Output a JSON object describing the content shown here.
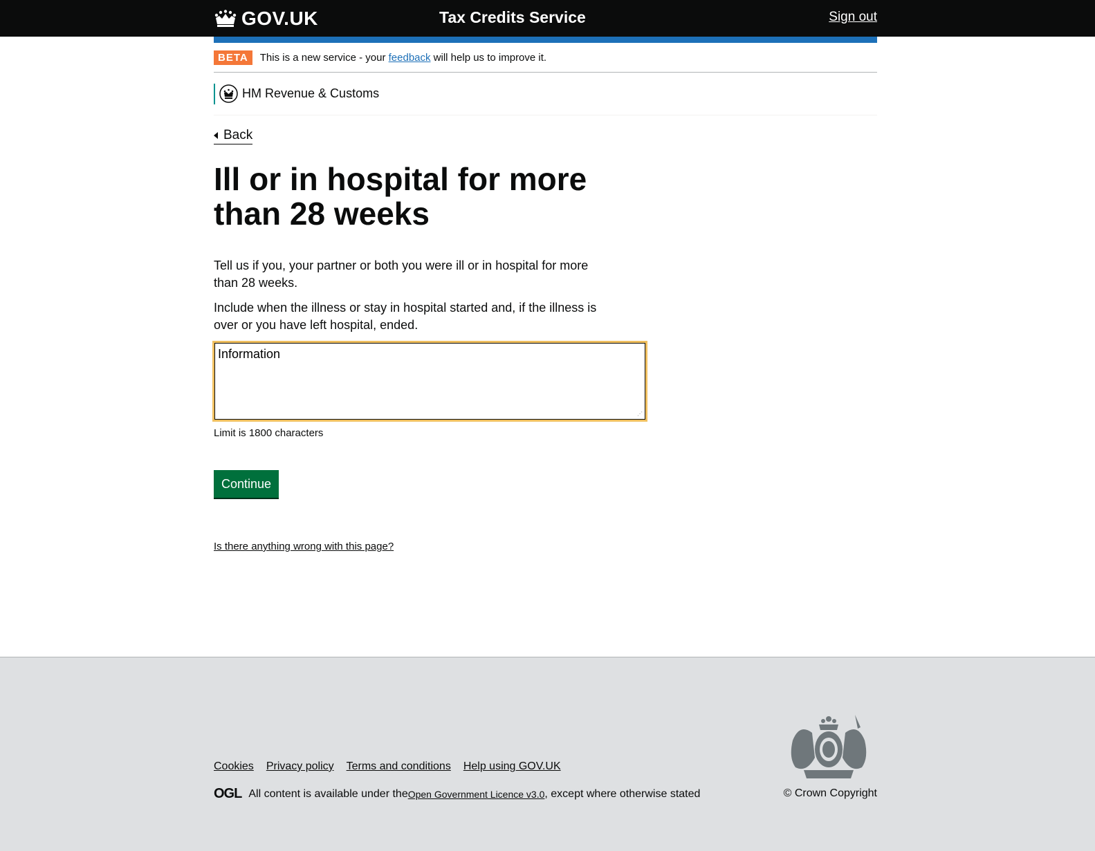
{
  "header": {
    "logo_text": "GOV.UK",
    "service_name": "Tax Credits Service",
    "signout_label": "Sign out"
  },
  "phase_banner": {
    "tag": "BETA",
    "text_before": "This is a new service - your ",
    "link_text": "feedback",
    "text_after": " will help us to improve it."
  },
  "organisation": {
    "name": "HM Revenue & Customs"
  },
  "back_link": "Back",
  "main": {
    "title": "Ill or in hospital for more than 28 weeks",
    "paragraph_1": "Tell us if you, your partner or both you were ill or in hospital for more than 28 weeks.",
    "paragraph_2": "Include when the illness or stay in hospital started and, if the illness is over or you have left hospital, ended.",
    "textarea_value": "Information",
    "hint": "Limit is 1800 characters",
    "continue_label": "Continue",
    "report_link": "Is there anything wrong with this page?"
  },
  "footer": {
    "links": [
      "Cookies",
      "Privacy policy",
      "Terms and conditions",
      "Help using GOV.UK"
    ],
    "ogl_logo": "OGL",
    "licence_before": "All content is available under the ",
    "licence_link": "Open Government Licence v3.0",
    "licence_after": ", except where otherwise stated",
    "copyright": "© Crown Copyright"
  },
  "colors": {
    "header_bg": "#0b0c0c",
    "blue_bar": "#1d70b8",
    "beta_tag": "#f47738",
    "focus": "#f0c060",
    "button": "#00703c",
    "footer_bg": "#dee0e2"
  }
}
